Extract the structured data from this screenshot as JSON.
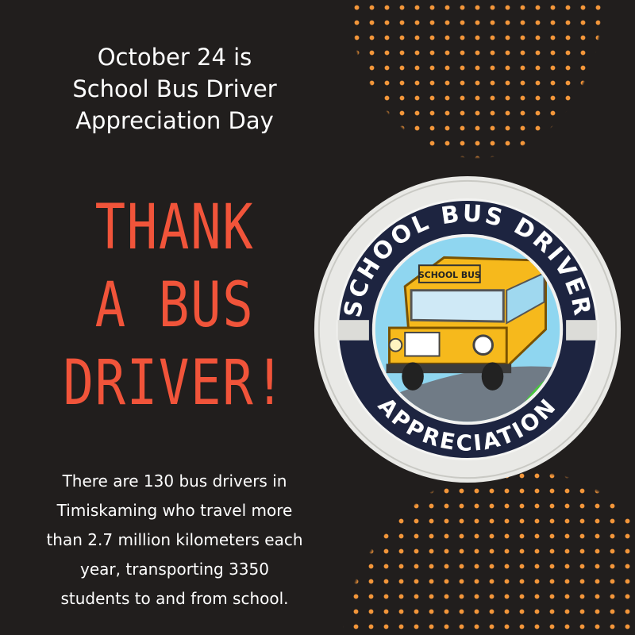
{
  "heading": "October 24 is\nSchool Bus Driver\nAppreciation Day",
  "headline": "THANK\nA BUS\nDRIVER!",
  "fact": "There are 130 bus drivers in\nTimiskaming who travel more\nthan 2.7 million kilometers each\nyear, transporting 3350\nstudents to and from school.",
  "badge": {
    "top_text": "SCHOOL BUS DRIVER",
    "bottom_text": "APPRECIATION",
    "bus_sign": "SCHOOL BUS"
  },
  "colors": {
    "background": "#211e1d",
    "dots": "#f3963a",
    "headline": "#f1543a",
    "text": "#ffffff",
    "badge_band": "#1d2440",
    "bus_yellow": "#f6b91c",
    "sky": "#8fd6f0",
    "grass": "#49c83d"
  }
}
